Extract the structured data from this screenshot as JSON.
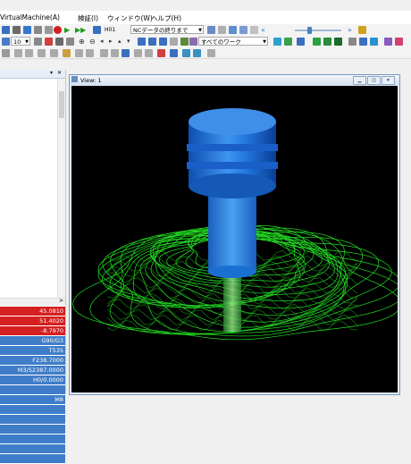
{
  "menu": {
    "items": [
      "VirtualMachine(A)",
      "検証(I)",
      "ウィンドウ(W)",
      "ヘルプ(H)"
    ]
  },
  "toolbar": {
    "nc_combo_value": "NCデータの終りまで",
    "step_value": "10",
    "work_combo_value": "すべてのワーク",
    "step_label": "H01"
  },
  "view": {
    "title": "View: 1"
  },
  "left_panel": {
    "values": [
      {
        "text": "45.0810",
        "color": "red"
      },
      {
        "text": "51.4020",
        "color": "red"
      },
      {
        "text": "-8.7970",
        "color": "red"
      },
      {
        "text": "G90/G3",
        "color": "blue"
      },
      {
        "text": "T535",
        "color": "blue"
      },
      {
        "text": "F238.7000",
        "color": "blue"
      },
      {
        "text": "M3/S2387.0000",
        "color": "blue"
      },
      {
        "text": "H0/0.0000",
        "color": "blue"
      },
      {
        "text": "",
        "color": "blue"
      },
      {
        "text": "M8",
        "color": "blue"
      },
      {
        "text": "",
        "color": "blue"
      },
      {
        "text": "",
        "color": "blue"
      },
      {
        "text": "",
        "color": "blue"
      },
      {
        "text": "",
        "color": "blue"
      },
      {
        "text": "",
        "color": "blue"
      },
      {
        "text": "",
        "color": "blue"
      }
    ]
  },
  "colors": {
    "tool": "#2f7fe0",
    "toolpath": "#22e022",
    "viewport_bg": "#000000",
    "red_row": "#d42020",
    "blue_row": "#3f7dc8"
  }
}
